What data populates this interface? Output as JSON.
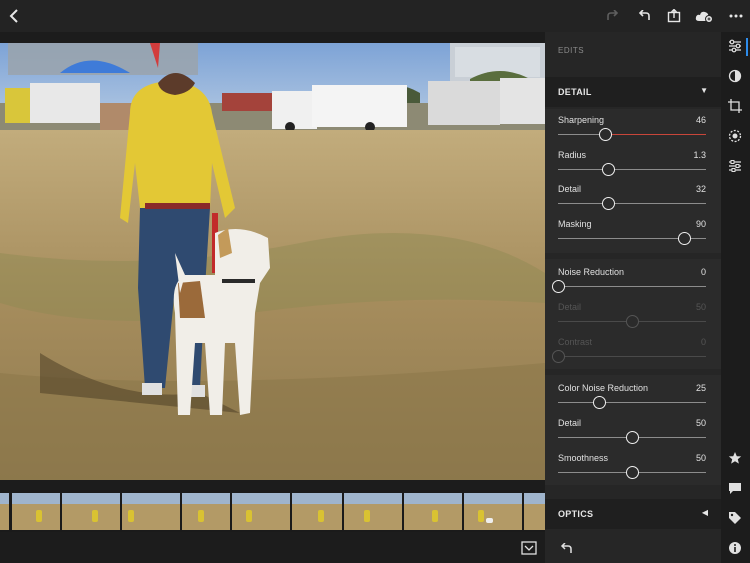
{
  "topbar": {
    "back_icon": "chevron-left-icon",
    "redo_icon": "redo-icon",
    "undo_icon": "undo-icon",
    "share_icon": "share-icon",
    "cloud_icon": "cloud-sync-icon",
    "more_icon": "more-icon"
  },
  "panel": {
    "edits_title": "EDITS",
    "detail_section": {
      "label": "DETAIL",
      "sharpening": [
        {
          "name": "Sharpening",
          "value": "46",
          "level": 0.32,
          "accent": "#c8463a"
        },
        {
          "name": "Radius",
          "value": "1.3",
          "level": 0.34
        },
        {
          "name": "Detail",
          "value": "32",
          "level": 0.34
        },
        {
          "name": "Masking",
          "value": "90",
          "level": 0.85
        }
      ],
      "noise": [
        {
          "name": "Noise Reduction",
          "value": "0",
          "level": 0.0
        },
        {
          "name": "Detail",
          "value": "50",
          "level": 0.5
        },
        {
          "name": "Contrast",
          "value": "0",
          "level": 0.0
        }
      ],
      "color_noise": [
        {
          "name": "Color Noise Reduction",
          "value": "25",
          "level": 0.28
        },
        {
          "name": "Detail",
          "value": "50",
          "level": 0.5
        },
        {
          "name": "Smoothness",
          "value": "50",
          "level": 0.5
        }
      ]
    },
    "optics_section": {
      "label": "OPTICS"
    }
  },
  "rightrail": {
    "icons": [
      "adjustments-icon",
      "presets-icon",
      "crop-icon",
      "healing-icon",
      "selective-icon",
      "star-icon",
      "comment-icon",
      "tag-icon",
      "info-icon"
    ]
  },
  "bottombar": {
    "filmstrip_toggle_icon": "filmstrip-toggle-icon",
    "reset_icon": "reset-icon"
  },
  "colors": {
    "accent": "#2d8ceb",
    "sharpening_fill": "#c8463a"
  }
}
